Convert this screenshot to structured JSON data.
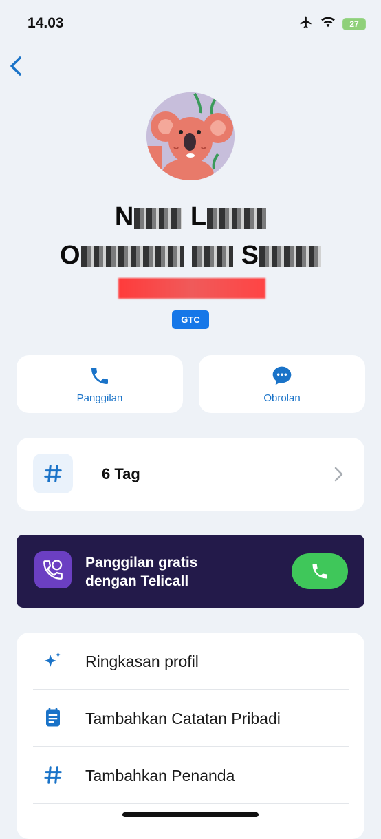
{
  "status_bar": {
    "time": "14.03",
    "battery": "27"
  },
  "profile": {
    "name_line1_start": "N",
    "name_line1_mid": "L",
    "name_line2_start": "O",
    "name_line2_mid": "S",
    "badge": "GTC"
  },
  "actions": {
    "call_label": "Panggilan",
    "chat_label": "Obrolan"
  },
  "tags": {
    "label": "6 Tag"
  },
  "promo": {
    "line1": "Panggilan gratis",
    "line2": "dengan Telicall"
  },
  "menu": {
    "items": [
      {
        "label": "Ringkasan profil",
        "icon": "sparkle-icon"
      },
      {
        "label": "Tambahkan Catatan Pribadi",
        "icon": "note-icon"
      },
      {
        "label": "Tambahkan Penanda",
        "icon": "hashtag-icon"
      }
    ]
  },
  "colors": {
    "accent": "#1677e8",
    "promo_bg": "#231a4a",
    "green": "#3fc75a"
  }
}
